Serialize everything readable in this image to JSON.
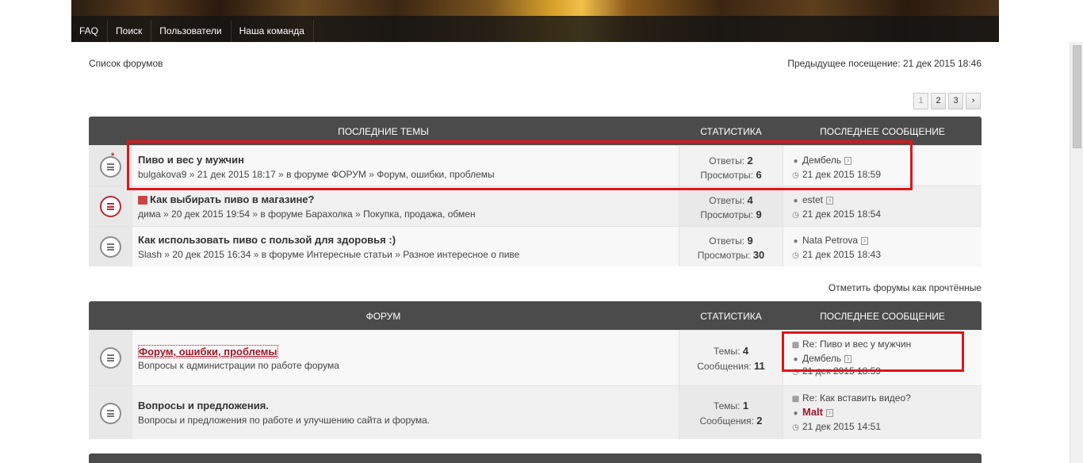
{
  "nav": [
    "FAQ",
    "Поиск",
    "Пользователи",
    "Наша команда"
  ],
  "breadcrumb": "Список форумов",
  "last_visit": "Предыдущее посещение: 21 дек 2015 18:46",
  "pagination": [
    "1",
    "2",
    "3",
    "›"
  ],
  "latest": {
    "headers": {
      "topics": "ПОСЛЕДНИЕ ТЕМЫ",
      "stats": "СТАТИСТИКА",
      "last": "ПОСЛЕДНЕЕ СООБЩЕНИЕ"
    },
    "rows": [
      {
        "title": "Пиво и вес у мужчин",
        "author": "bulgakova9",
        "date": "21 дек 2015 18:17",
        "in_forum": "в форуме",
        "forum": "ФОРУМ",
        "subforum": "Форум, ошибки, проблемы",
        "replies_label": "Ответы:",
        "replies": "2",
        "views_label": "Просмотры:",
        "views": "6",
        "last_user": "Дембель",
        "last_date": "21 дек 2015 18:59"
      },
      {
        "title": "Как выбирать пиво в магазине?",
        "author": "дима",
        "date": "20 дек 2015 19:54",
        "in_forum": "в форуме",
        "forum": "Барахолка",
        "subforum": "Покупка, продажа, обмен",
        "replies_label": "Ответы:",
        "replies": "4",
        "views_label": "Просмотры:",
        "views": "9",
        "last_user": "estet",
        "last_date": "21 дек 2015 18:54"
      },
      {
        "title": "Как использовать пиво с пользой для здоровья :)",
        "author": "Slash",
        "date": "20 дек 2015 16:34",
        "in_forum": "в форуме",
        "forum": "Интересные статьи",
        "subforum": "Разное интересное о пиве",
        "replies_label": "Ответы:",
        "replies": "9",
        "views_label": "Просмотры:",
        "views": "30",
        "last_user": "Nata Petrova",
        "last_date": "21 дек 2015 18:43"
      }
    ]
  },
  "mark_read": "Отметить форумы как прочтённые",
  "forums": {
    "headers": {
      "forum": "ФОРУМ",
      "stats": "СТАТИСТИКА",
      "last": "ПОСЛЕДНЕЕ СООБЩЕНИЕ"
    },
    "rows": [
      {
        "title": "Форум, ошибки, проблемы",
        "desc": "Вопросы к администрации по работе форума",
        "topics_label": "Темы:",
        "topics": "4",
        "posts_label": "Сообщения:",
        "posts": "11",
        "last_subject": "Re: Пиво и вес у мужчин",
        "last_user": "Дембель",
        "last_date": "21 дек 2015 18:59"
      },
      {
        "title": "Вопросы и предложения.",
        "desc": "Вопросы и предложения по работе и улучшению сайта и форума.",
        "topics_label": "Темы:",
        "topics": "1",
        "posts_label": "Сообщения:",
        "posts": "2",
        "last_subject": "Re: Как вставить видео?",
        "last_user": "Malt",
        "last_date": "21 дек 2015 14:51"
      }
    ]
  },
  "sep": "»"
}
